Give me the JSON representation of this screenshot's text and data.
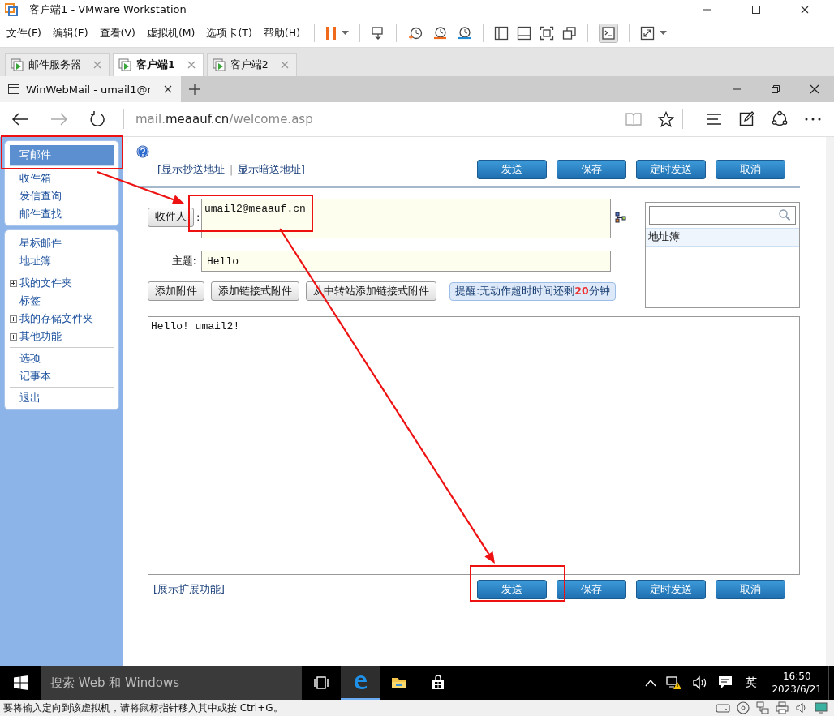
{
  "vm_window": {
    "title": "客户端1 - VMware Workstation",
    "menus": [
      "文件(F)",
      "编辑(E)",
      "查看(V)",
      "虚拟机(M)",
      "选项卡(T)",
      "帮助(H)"
    ],
    "tabs": [
      {
        "label": "邮件服务器",
        "selected": false
      },
      {
        "label": "客户端1",
        "selected": true
      },
      {
        "label": "客户端2",
        "selected": false
      }
    ],
    "status_text": "要将输入定向到该虚拟机，请将鼠标指针移入其中或按 Ctrl+G。"
  },
  "browser": {
    "tab_title": "WinWebMail - umail1@r",
    "url_prefix": "mail.",
    "url_domain": "meaauf.cn",
    "url_path": "/welcome.asp"
  },
  "sidebar": {
    "panels": [
      {
        "groups": [
          [
            {
              "label": "写邮件",
              "kind": "link",
              "selected": true
            },
            {
              "label": "收件箱",
              "kind": "link",
              "selected": false
            },
            {
              "label": "发信查询",
              "kind": "link",
              "selected": false
            },
            {
              "label": "邮件查找",
              "kind": "link",
              "selected": false
            }
          ]
        ]
      },
      {
        "groups": [
          [
            {
              "label": "星标邮件",
              "kind": "link",
              "selected": false
            },
            {
              "label": "地址簿",
              "kind": "link",
              "selected": false
            }
          ],
          [
            {
              "label": "我的文件夹",
              "kind": "tree",
              "expanded": false,
              "selected": false
            },
            {
              "label": "标签",
              "kind": "link",
              "selected": false
            },
            {
              "label": "我的存储文件夹",
              "kind": "tree",
              "expanded": false,
              "selected": false
            },
            {
              "label": "其他功能",
              "kind": "tree",
              "expanded": false,
              "selected": false
            }
          ],
          [
            {
              "label": "选项",
              "kind": "link",
              "selected": false
            },
            {
              "label": "记事本",
              "kind": "link",
              "selected": false
            }
          ],
          [
            {
              "label": "退出",
              "kind": "link",
              "selected": false
            }
          ]
        ]
      }
    ]
  },
  "compose": {
    "bracket_open": "[",
    "address_links": [
      "显示抄送地址",
      "显示暗送地址"
    ],
    "separator": "|",
    "bracket_close": "]",
    "actions": [
      "发送",
      "保存",
      "定时发送",
      "取消"
    ],
    "recipient_button": "收件人",
    "recipient_colon": ":",
    "recipient_value": "umail2@meaauf.cn",
    "subject_label": "主题:",
    "subject_value": "Hello",
    "attach_buttons": [
      "添加附件",
      "添加链接式附件",
      "从中转站添加链接式附件"
    ],
    "reminder": "提醒:无动作超时时间还剩**20**分钟",
    "body": "Hello! umail2!",
    "expand_link": "[展示扩展功能]",
    "bottom_actions": [
      "发送",
      "保存",
      "定时发送",
      "取消"
    ]
  },
  "address_book": {
    "title": "地址簿"
  },
  "taskbar": {
    "search_placeholder": "搜索 Web 和 Windows",
    "apps": [
      {
        "kind": "task-view",
        "selected": false
      },
      {
        "kind": "edge",
        "selected": true
      },
      {
        "kind": "explorer",
        "selected": false
      },
      {
        "kind": "store",
        "selected": false
      }
    ],
    "ime": "英",
    "time": "16:50",
    "date": "2023/6/21"
  },
  "annotations": [
    {
      "kind": "box"
    },
    {
      "kind": "box"
    },
    {
      "kind": "box"
    },
    {
      "kind": "arrow"
    },
    {
      "kind": "arrow"
    }
  ]
}
